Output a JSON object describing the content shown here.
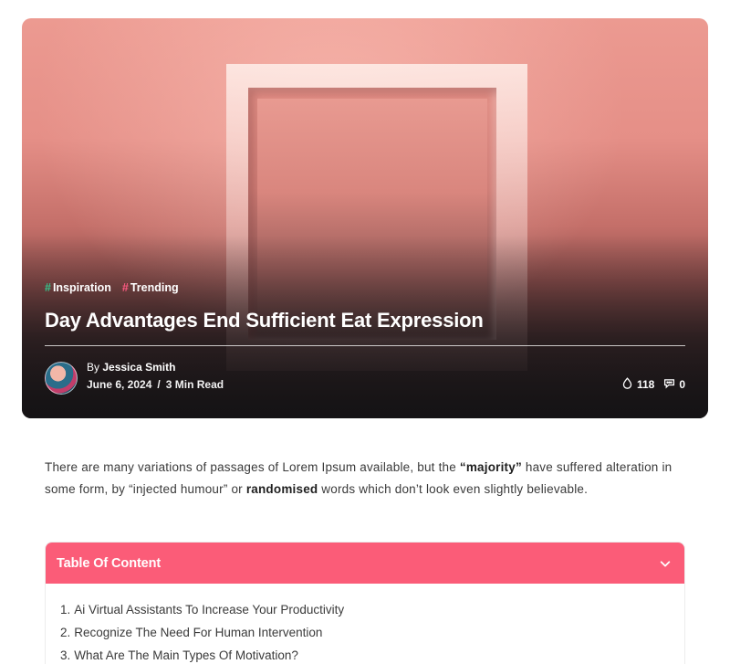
{
  "hero": {
    "tags": [
      {
        "hash": "#",
        "label": "Inspiration",
        "hash_color": "#34c58c"
      },
      {
        "hash": "#",
        "label": "Trending",
        "hash_color": "#ff5a82"
      }
    ],
    "title": "Day Advantages End Sufficient Eat Expression",
    "author_prefix": "By",
    "author_name": "Jessica Smith",
    "date": "June 6, 2024",
    "separator": "/",
    "read_time": "3 Min Read",
    "views_count": "118",
    "comments_count": "0",
    "views_icon": "drop-icon",
    "comments_icon": "comment-icon"
  },
  "intro": {
    "part1": "There are many variations of passages of Lorem Ipsum available, but the ",
    "bold1": "“majority”",
    "part2": " have suffered alteration in some form, by “injected humour” or ",
    "bold2": "randomised",
    "part3": " words which don’t look even slightly believable."
  },
  "toc": {
    "title": "Table Of Content",
    "chevron_icon": "chevron-down-icon",
    "accent_color": "#fb5c78",
    "items": [
      {
        "num": "1.",
        "label": "Ai Virtual Assistants To Increase Your Productivity"
      },
      {
        "num": "2.",
        "label": "Recognize The Need For Human Intervention"
      },
      {
        "num": "3.",
        "label": "What Are The Main Types Of Motivation?"
      }
    ]
  }
}
